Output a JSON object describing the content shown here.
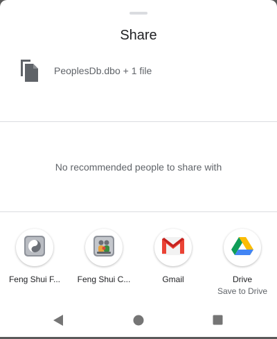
{
  "sheet": {
    "title": "Share",
    "file_label": "PeoplesDb.dbo + 1 file",
    "empty_people_text": "No recommended people to share with"
  },
  "apps": [
    {
      "label": "Feng Shui F...",
      "sublabel": "",
      "icon": "feng-shui-yin-yang-icon"
    },
    {
      "label": "Feng Shui C...",
      "sublabel": "",
      "icon": "feng-shui-family-icon"
    },
    {
      "label": "Gmail",
      "sublabel": "",
      "icon": "gmail-icon"
    },
    {
      "label": "Drive",
      "sublabel": "Save to Drive",
      "icon": "google-drive-icon"
    }
  ],
  "navbar": {
    "back_icon": "back-triangle-icon",
    "home_icon": "home-circle-icon",
    "recents_icon": "recents-square-icon"
  },
  "colors": {
    "gmail_red": "#EA4335",
    "drive_green": "#0F9D58",
    "drive_yellow": "#FBBC04",
    "drive_blue": "#4285F4",
    "nav_gray": "#757575"
  }
}
